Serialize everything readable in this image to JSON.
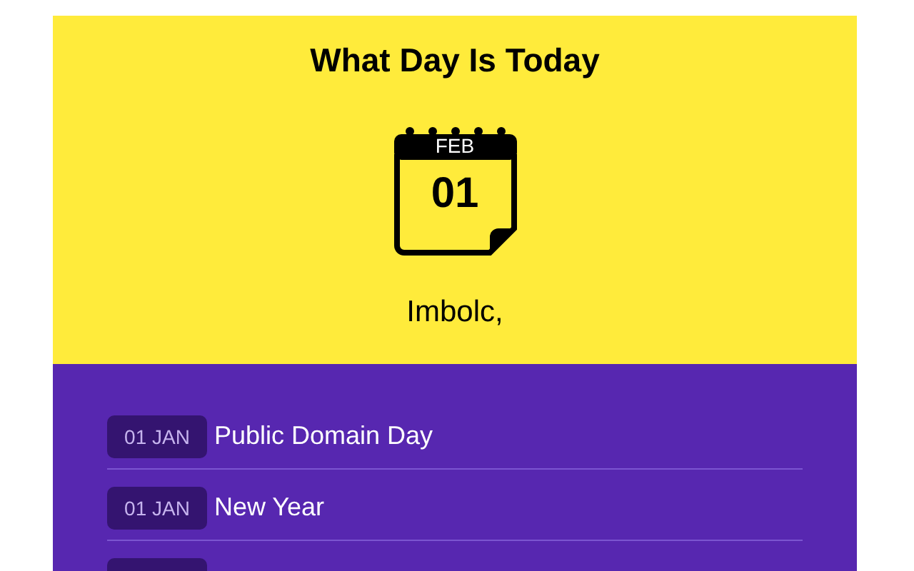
{
  "title": "What Day Is Today",
  "calendar": {
    "month": "FEB",
    "day": "01"
  },
  "holiday": "Imbolc,",
  "events": [
    {
      "kind": "event",
      "date": "01 JAN",
      "name": "Public Domain Day"
    },
    {
      "kind": "event",
      "date": "01 JAN",
      "name": "New Year"
    },
    {
      "kind": "cut"
    }
  ]
}
